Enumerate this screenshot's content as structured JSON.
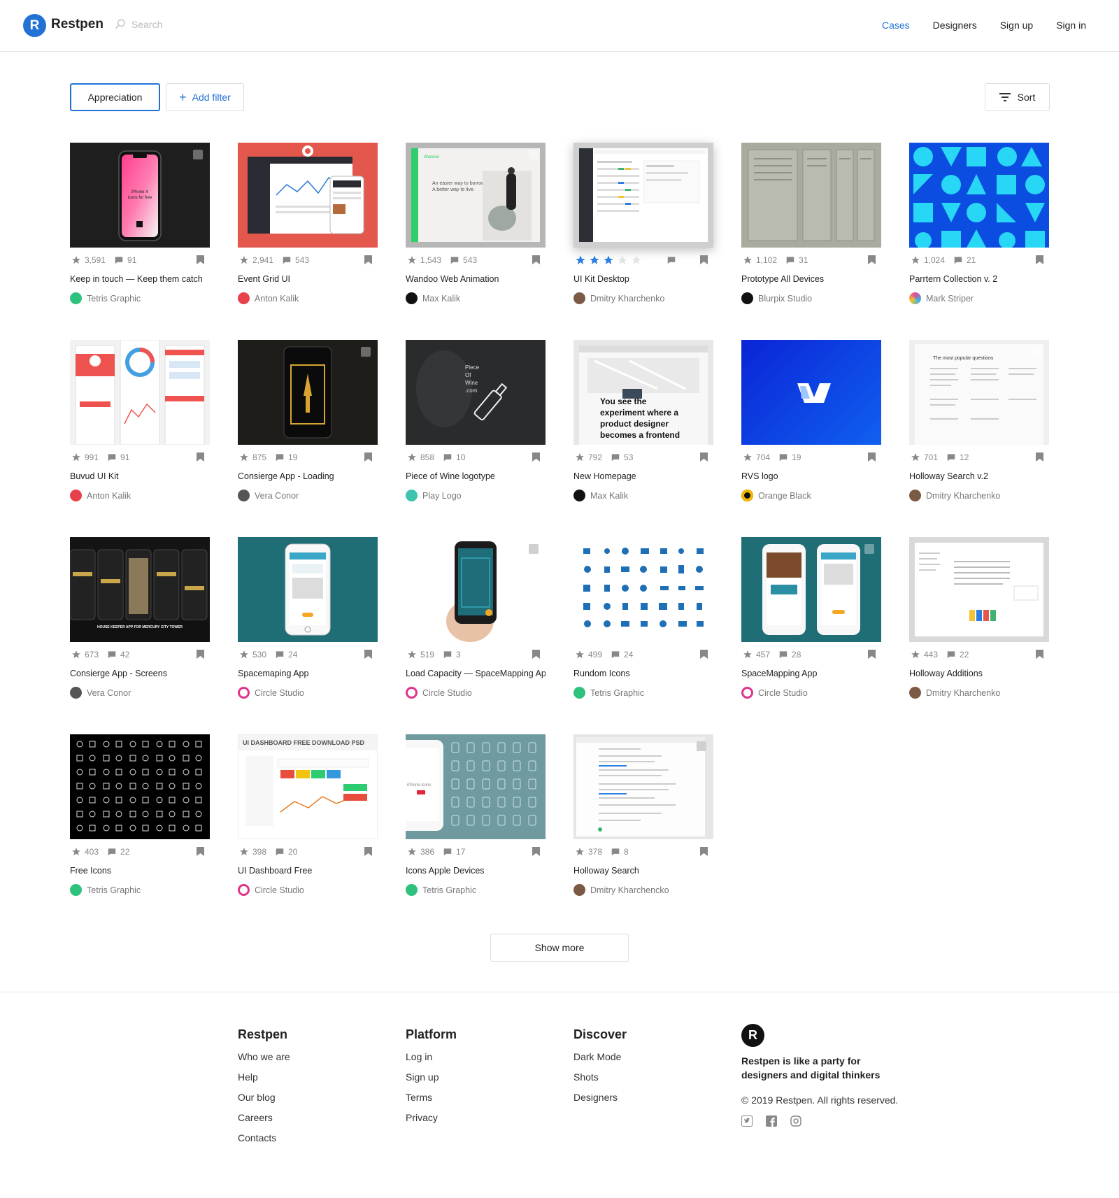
{
  "header": {
    "brand": "Restpen",
    "logo_letter": "R",
    "search_placeholder": "Search",
    "nav": [
      "Cases",
      "Designers",
      "Sign up",
      "Sign in"
    ],
    "active_nav": "Cases"
  },
  "filters": {
    "appreciation": "Appreciation",
    "add_filter": "Add filter",
    "sort": "Sort"
  },
  "cards": [
    {
      "likes": "3,591",
      "comments": "91",
      "title": "Keep in touch — Keep them catch",
      "author": "Tetris Graphic"
    },
    {
      "likes": "2,941",
      "comments": "543",
      "title": "Event Grid UI",
      "author": "Anton Kalik"
    },
    {
      "likes": "1,543",
      "comments": "543",
      "title": "Wandoo Web Animation",
      "author": "Max Kalik"
    },
    {
      "likes": "",
      "comments": "",
      "title": "UI Kit Desktop",
      "author": "Dmitry Kharchenko",
      "rating": 3
    },
    {
      "likes": "1,102",
      "comments": "31",
      "title": "Prototype All Devices",
      "author": "Blurpix Studio"
    },
    {
      "likes": "1,024",
      "comments": "21",
      "title": "Parrtern Collection v. 2",
      "author": "Mark Striper"
    },
    {
      "likes": "991",
      "comments": "91",
      "title": "Buvud UI Kit",
      "author": "Anton Kalik"
    },
    {
      "likes": "875",
      "comments": "19",
      "title": "Consierge App - Loading",
      "author": "Vera Conor"
    },
    {
      "likes": "858",
      "comments": "10",
      "title": "Piece of Wine logotype",
      "author": "Play Logo"
    },
    {
      "likes": "792",
      "comments": "53",
      "title": "New Homepage",
      "author": "Max Kalik"
    },
    {
      "likes": "704",
      "comments": "19",
      "title": "RVS logo",
      "author": "Orange Black"
    },
    {
      "likes": "701",
      "comments": "12",
      "title": "Holloway Search v.2",
      "author": "Dmitry Kharchenko"
    },
    {
      "likes": "673",
      "comments": "42",
      "title": "Consierge App - Screens",
      "author": "Vera Conor"
    },
    {
      "likes": "530",
      "comments": "24",
      "title": "Spacemaping App",
      "author": "Circle Studio"
    },
    {
      "likes": "519",
      "comments": "3",
      "title": "Load Capacity — SpaceMapping App",
      "author": "Circle Studio"
    },
    {
      "likes": "499",
      "comments": "24",
      "title": "Rundom Icons",
      "author": "Tetris Graphic"
    },
    {
      "likes": "457",
      "comments": "28",
      "title": "SpaceMapping App",
      "author": "Circle Studio"
    },
    {
      "likes": "443",
      "comments": "22",
      "title": "Holloway Additions",
      "author": "Dmitry Kharchenko"
    },
    {
      "likes": "403",
      "comments": "22",
      "title": "Free Icons",
      "author": "Tetris Graphic"
    },
    {
      "likes": "398",
      "comments": "20",
      "title": "UI Dashboard Free",
      "author": "Circle Studio"
    },
    {
      "likes": "386",
      "comments": "17",
      "title": "Icons Apple Devices",
      "author": "Tetris Graphic"
    },
    {
      "likes": "378",
      "comments": "8",
      "title": "Holloway Search",
      "author": "Dmitry Kharchencko"
    }
  ],
  "thumb_texts": {
    "iphone": "iPhone X icons for free",
    "wandoo_brand": "Wandoo",
    "wandoo_tag": "An easier way to borrow. A better way to live.",
    "wine": "Piece Of Wine .com",
    "homepage": "You see the experiment where a product designer becomes a frontend",
    "dashboard": "UI DASHBOARD FREE DOWNLOAD PSD",
    "housekeeper": "HOUSE KEEPER APP FOR MERCURY CITY TOWER",
    "popular": "The most popular questions"
  },
  "show_more": "Show more",
  "footer": {
    "col1": {
      "title": "Restpen",
      "links": [
        "Who we are",
        "Help",
        "Our blog",
        "Careers",
        "Contacts"
      ]
    },
    "col2": {
      "title": "Platform",
      "links": [
        "Log in",
        "Sign up",
        "Terms",
        "Privacy"
      ]
    },
    "col3": {
      "title": "Discover",
      "links": [
        "Dark Mode",
        "Shots",
        "Designers"
      ]
    },
    "logo_letter": "R",
    "tagline": "Restpen is like a party for designers and digital thinkers",
    "copyright": "© 2019 Restpen. All rights reserved."
  },
  "colors": {
    "accent": "#2272d6",
    "star": "#888888",
    "star_active": "#2a7de1"
  }
}
